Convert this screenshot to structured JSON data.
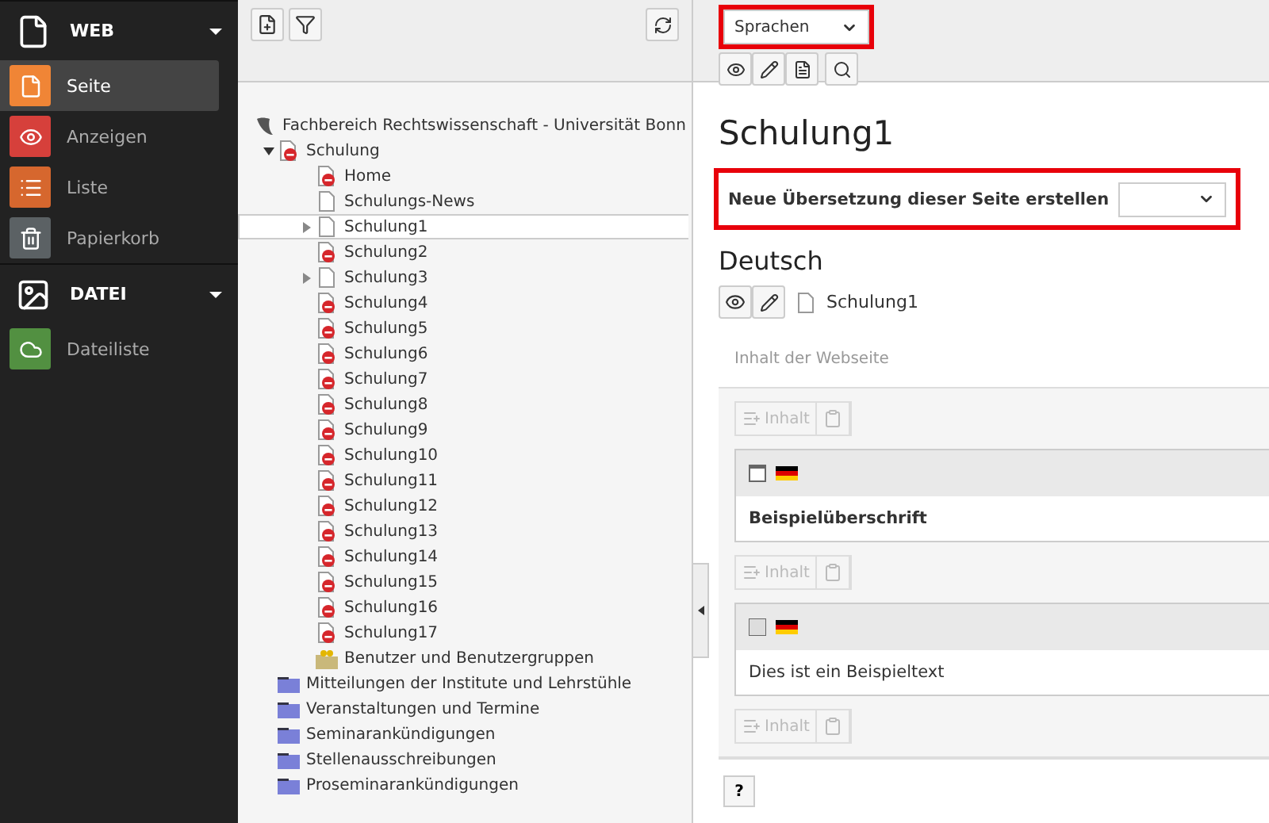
{
  "sidebar": {
    "groups": [
      {
        "title": "WEB",
        "expanded": true,
        "items": [
          {
            "label": "Seite",
            "color": "#f08536",
            "selected": true
          },
          {
            "label": "Anzeigen",
            "color": "#d6403b",
            "selected": false
          },
          {
            "label": "Liste",
            "color": "#d6672e",
            "selected": false
          },
          {
            "label": "Papierkorb",
            "color": "#5b6164",
            "selected": false
          }
        ]
      },
      {
        "title": "DATEI",
        "expanded": true,
        "items": [
          {
            "label": "Dateiliste",
            "color": "#529041",
            "selected": false
          }
        ]
      }
    ]
  },
  "tree": {
    "root": {
      "label": "Fachbereich Rechtswissenschaft - Universität Bonn",
      "children": [
        {
          "label": "Schulung",
          "kind": "hidden",
          "expanded": true,
          "selected": false,
          "children": [
            {
              "label": "Home",
              "kind": "hidden",
              "selected": false
            },
            {
              "label": "Schulungs-News",
              "kind": "page",
              "selected": false
            },
            {
              "label": "Schulung1",
              "kind": "page",
              "expanded": false,
              "selected": true
            },
            {
              "label": "Schulung2",
              "kind": "hidden",
              "selected": false
            },
            {
              "label": "Schulung3",
              "kind": "page",
              "expanded": false,
              "selected": false
            },
            {
              "label": "Schulung4",
              "kind": "hidden",
              "selected": false
            },
            {
              "label": "Schulung5",
              "kind": "hidden",
              "selected": false
            },
            {
              "label": "Schulung6",
              "kind": "hidden",
              "selected": false
            },
            {
              "label": "Schulung7",
              "kind": "hidden",
              "selected": false
            },
            {
              "label": "Schulung8",
              "kind": "hidden",
              "selected": false
            },
            {
              "label": "Schulung9",
              "kind": "hidden",
              "selected": false
            },
            {
              "label": "Schulung10",
              "kind": "hidden",
              "selected": false
            },
            {
              "label": "Schulung11",
              "kind": "hidden",
              "selected": false
            },
            {
              "label": "Schulung12",
              "kind": "hidden",
              "selected": false
            },
            {
              "label": "Schulung13",
              "kind": "hidden",
              "selected": false
            },
            {
              "label": "Schulung14",
              "kind": "hidden",
              "selected": false
            },
            {
              "label": "Schulung15",
              "kind": "hidden",
              "selected": false
            },
            {
              "label": "Schulung16",
              "kind": "hidden",
              "selected": false
            },
            {
              "label": "Schulung17",
              "kind": "hidden",
              "selected": false
            },
            {
              "label": "Benutzer und Benutzergruppen",
              "kind": "usersfolder",
              "selected": false
            }
          ]
        },
        {
          "label": "Mitteilungen der Institute und Lehrstühle",
          "kind": "folder",
          "selected": false
        },
        {
          "label": "Veranstaltungen und Termine",
          "kind": "folder",
          "selected": false
        },
        {
          "label": "Seminarankündigungen",
          "kind": "folder",
          "selected": false
        },
        {
          "label": "Stellenausschreibungen",
          "kind": "folder",
          "selected": false
        },
        {
          "label": "Proseminarankündigungen",
          "kind": "folder",
          "selected": false
        }
      ]
    }
  },
  "content": {
    "view_select": "Sprachen",
    "title": "Schulung1",
    "translation_label": "Neue Übersetzung dieser Seite erstellen",
    "language": "Deutsch",
    "page_name": "Schulung1",
    "column_title": "Inhalt der Webseite",
    "new_content_labels": [
      "Inhalt",
      "Inhalt",
      "Inhalt"
    ],
    "elements": [
      {
        "kind": "header",
        "text": "Beispielüberschrift"
      },
      {
        "kind": "text",
        "text": "Dies ist ein Beispieltext"
      }
    ],
    "help": "?"
  }
}
